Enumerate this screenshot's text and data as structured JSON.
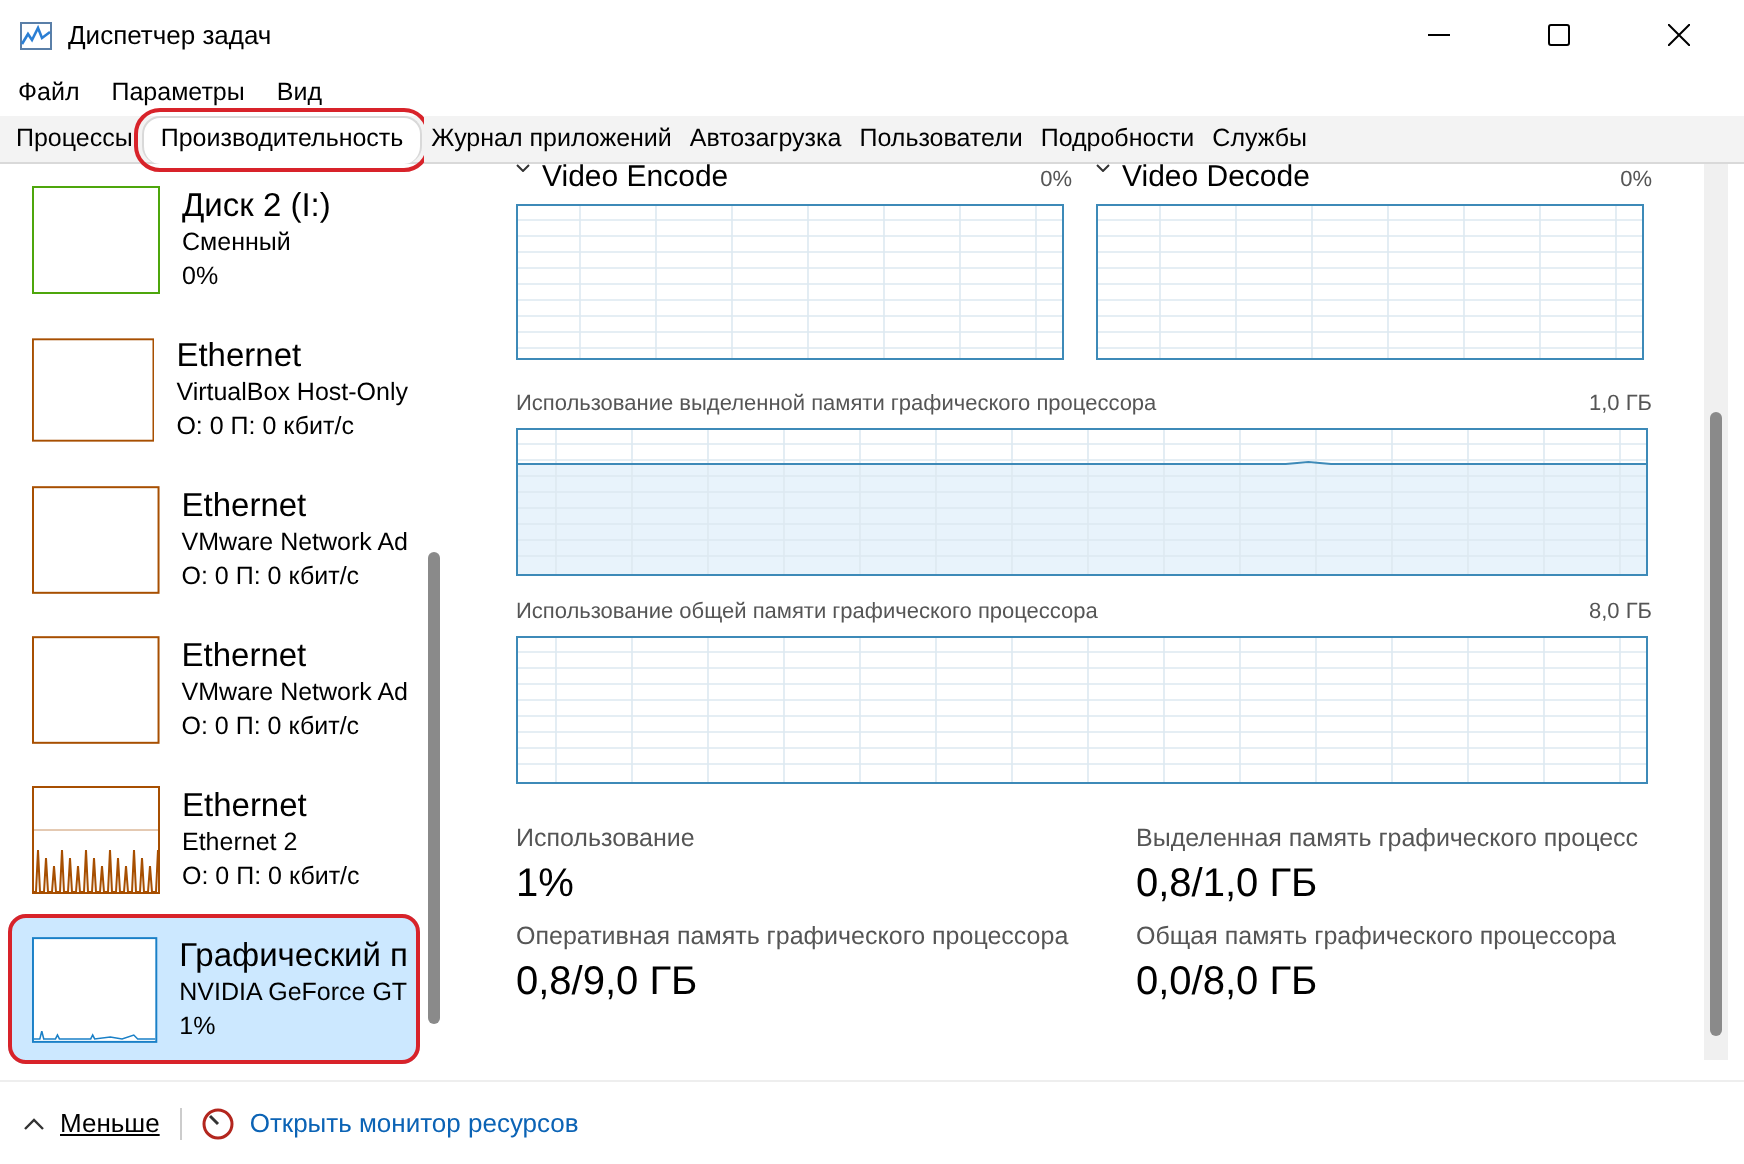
{
  "window": {
    "title": "Диспетчер задач"
  },
  "menu": [
    "Файл",
    "Параметры",
    "Вид"
  ],
  "tabs": [
    {
      "label": "Процессы",
      "selected": false,
      "annotated": false
    },
    {
      "label": "Производительность",
      "selected": true,
      "annotated": true
    },
    {
      "label": "Журнал приложений",
      "selected": false,
      "annotated": false
    },
    {
      "label": "Автозагрузка",
      "selected": false,
      "annotated": false
    },
    {
      "label": "Пользователи",
      "selected": false,
      "annotated": false
    },
    {
      "label": "Подробности",
      "selected": false,
      "annotated": false
    },
    {
      "label": "Службы",
      "selected": false,
      "annotated": false
    }
  ],
  "sidebar": {
    "items": [
      {
        "kind": "disk",
        "title": "Диск 2 (I:)",
        "subtitle": "Сменный",
        "value": "0%",
        "active": false,
        "selected": false,
        "annotated": false
      },
      {
        "kind": "ethernet",
        "title": "Ethernet",
        "subtitle": "VirtualBox Host-Only",
        "value": "О: 0 П: 0 кбит/с",
        "active": false,
        "selected": false,
        "annotated": false
      },
      {
        "kind": "ethernet",
        "title": "Ethernet",
        "subtitle": "VMware Network Ad",
        "value": "О: 0 П: 0 кбит/с",
        "active": false,
        "selected": false,
        "annotated": false
      },
      {
        "kind": "ethernet",
        "title": "Ethernet",
        "subtitle": "VMware Network Ad",
        "value": "О: 0 П: 0 кбит/с",
        "active": false,
        "selected": false,
        "annotated": false
      },
      {
        "kind": "ethernet",
        "title": "Ethernet",
        "subtitle": "Ethernet 2",
        "value": "О: 0 П: 0 кбит/с",
        "active": true,
        "selected": false,
        "annotated": false
      },
      {
        "kind": "gpu",
        "title": "Графический п",
        "subtitle": "NVIDIA GeForce GT",
        "value": "1%",
        "active": true,
        "selected": true,
        "annotated": true
      }
    ]
  },
  "engines": [
    {
      "label": "Video Encode",
      "value": "0%"
    },
    {
      "label": "Video Decode",
      "value": "0%"
    }
  ],
  "memory_graphs": [
    {
      "label": "Использование выделенной памяти графического процессора",
      "max": "1,0 ГБ",
      "filled": true
    },
    {
      "label": "Использование общей памяти графического процессора",
      "max": "8,0 ГБ",
      "filled": false
    }
  ],
  "stats": [
    {
      "label": "Использование",
      "value": "1%"
    },
    {
      "label": "Выделенная память графического процесс",
      "value": "0,8/1,0 ГБ"
    },
    {
      "label": "Оперативная память графического процессора",
      "value": "0,8/9,0 ГБ"
    },
    {
      "label": "Общая память графического процессора",
      "value": "0,0/8,0 ГБ"
    }
  ],
  "footer": {
    "less": "Меньше",
    "link": "Открыть монитор ресурсов"
  }
}
